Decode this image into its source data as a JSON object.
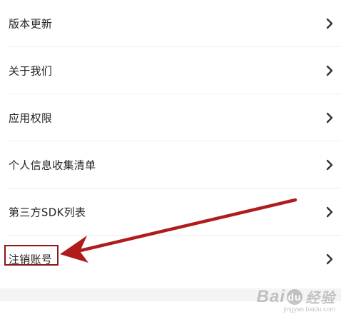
{
  "settings": {
    "items": [
      {
        "label": "版本更新",
        "icon": "chevron-right-icon"
      },
      {
        "label": "关于我们",
        "icon": "chevron-right-icon"
      },
      {
        "label": "应用权限",
        "icon": "chevron-right-icon"
      },
      {
        "label": "个人信息收集清单",
        "icon": "chevron-right-icon"
      },
      {
        "label": "第三方SDK列表",
        "icon": "chevron-right-icon"
      },
      {
        "label": "注销账号",
        "icon": "chevron-right-icon"
      }
    ]
  },
  "annotation": {
    "highlight_color": "#8c1818",
    "arrow_color": "#b01c1c",
    "target": "注销账号"
  },
  "watermark": {
    "brand": "Bai",
    "brand_paw": "du",
    "brand_cn": "经验",
    "url": "jingyan.baidu.com"
  },
  "colors": {
    "text": "#222222",
    "chevron": "#333333",
    "divider": "#eeeeee",
    "footer_band": "#f4f4f4"
  }
}
